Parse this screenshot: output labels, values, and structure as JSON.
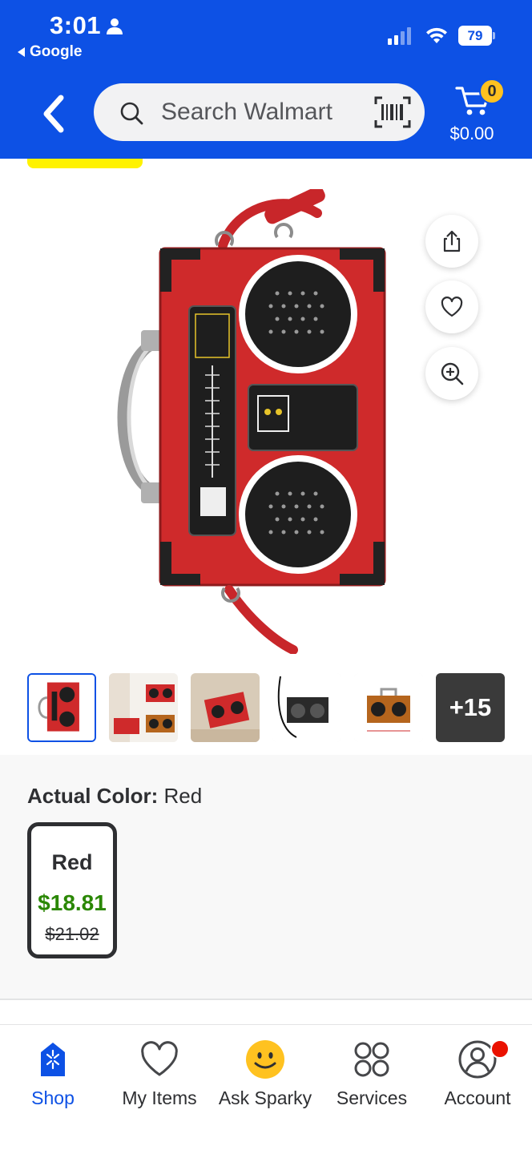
{
  "status_bar": {
    "time": "3:01",
    "back_app": "Google",
    "battery": "79"
  },
  "header": {
    "search_placeholder": "Search Walmart",
    "cart_count": "0",
    "cart_total": "$0.00"
  },
  "product": {
    "more_images_label": "+15",
    "variant_label": "Actual Color:",
    "variant_value": "Red",
    "variants": [
      {
        "name": "Red",
        "price": "$18.81",
        "was_price": "$21.02"
      }
    ]
  },
  "bottom_nav": {
    "items": [
      {
        "label": "Shop"
      },
      {
        "label": "My Items"
      },
      {
        "label": "Ask Sparky"
      },
      {
        "label": "Services"
      },
      {
        "label": "Account"
      }
    ]
  },
  "colors": {
    "brand_blue": "#0d51e5",
    "spark_yellow": "#ffc220",
    "price_green": "#2a8703",
    "notification_red": "#ea1100"
  }
}
